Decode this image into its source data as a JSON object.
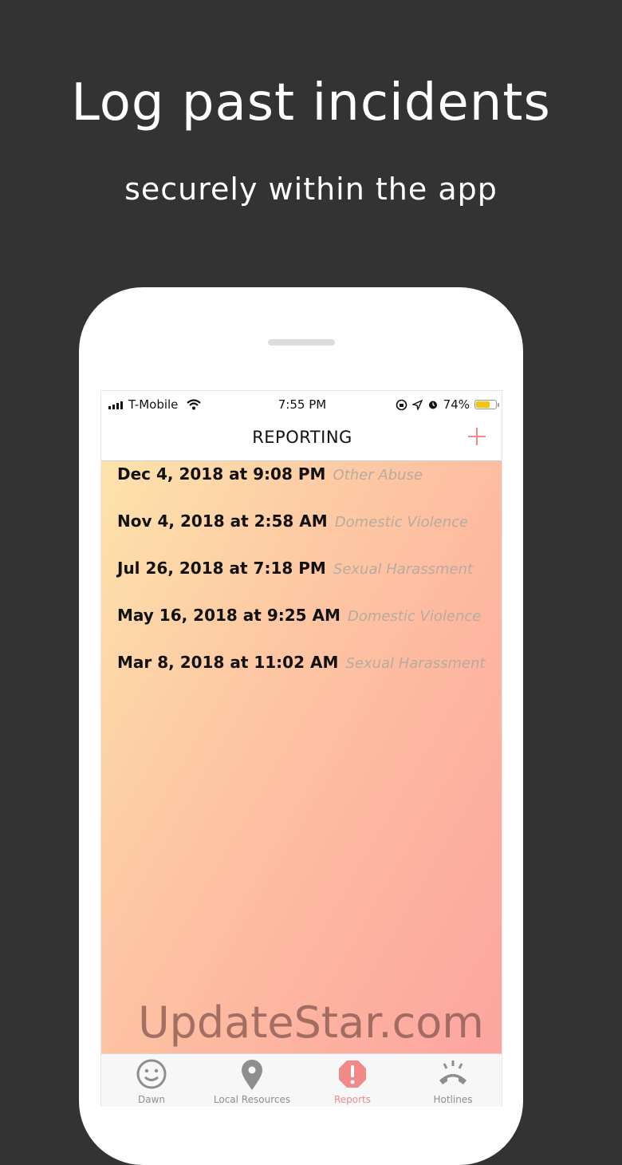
{
  "promo": {
    "title": "Log past incidents",
    "subtitle": "securely within the app"
  },
  "status_bar": {
    "carrier": "T-Mobile",
    "time": "7:55 PM",
    "battery": "74%",
    "battery_level": 0.74,
    "battery_color": "#f6c40a"
  },
  "nav": {
    "title": "REPORTING",
    "add_icon": "plus-icon",
    "accent": "#f28a8a"
  },
  "reports": [
    {
      "date": "Dec 4, 2018 at 9:08 PM",
      "type": "Other Abuse"
    },
    {
      "date": "Nov 4, 2018 at 2:58 AM",
      "type": "Domestic Violence"
    },
    {
      "date": "Jul 26, 2018 at 7:18 PM",
      "type": "Sexual Harassment"
    },
    {
      "date": "May 16, 2018 at 9:25 AM",
      "type": "Domestic Violence"
    },
    {
      "date": "Mar 8, 2018 at 11:02 AM",
      "type": "Sexual Harassment"
    }
  ],
  "tabs": [
    {
      "label": "Dawn",
      "icon": "smiley-icon",
      "active": false
    },
    {
      "label": "Local Resources",
      "icon": "map-pin-icon",
      "active": false
    },
    {
      "label": "Reports",
      "icon": "alert-icon",
      "active": true
    },
    {
      "label": "Hotlines",
      "icon": "phone-icon",
      "active": false
    }
  ],
  "watermark": "UpdateStar.com"
}
